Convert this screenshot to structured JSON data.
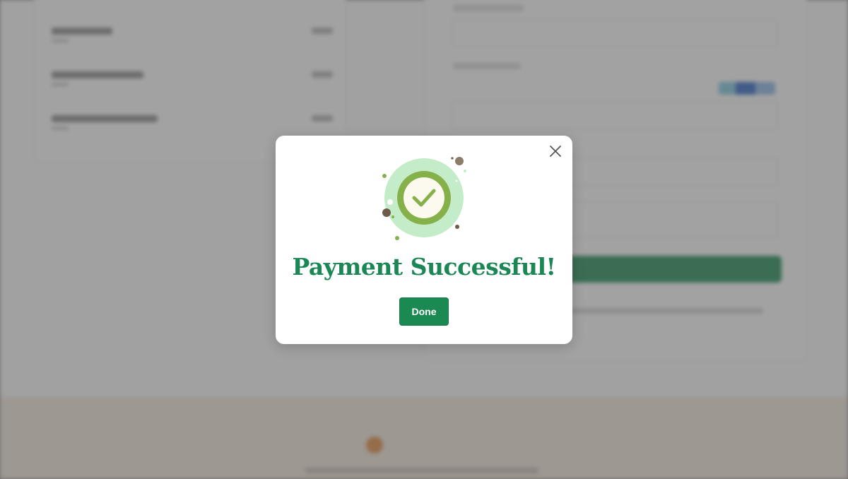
{
  "modal": {
    "title": "Payment Successful!",
    "done_label": "Done",
    "close_icon": "close-icon",
    "illustration_icon": "success-check-icon",
    "colors": {
      "accent": "#1b8a52",
      "title": "#1a8755",
      "ring_outer": "#c4ecc9",
      "ring_inner": "#86b04a",
      "dot_brown": "#6e5c4a"
    }
  },
  "background": {
    "brand_logo": "logo-icon",
    "brand_color": "#e28a3e",
    "footer_color": "#f4e8dc"
  }
}
